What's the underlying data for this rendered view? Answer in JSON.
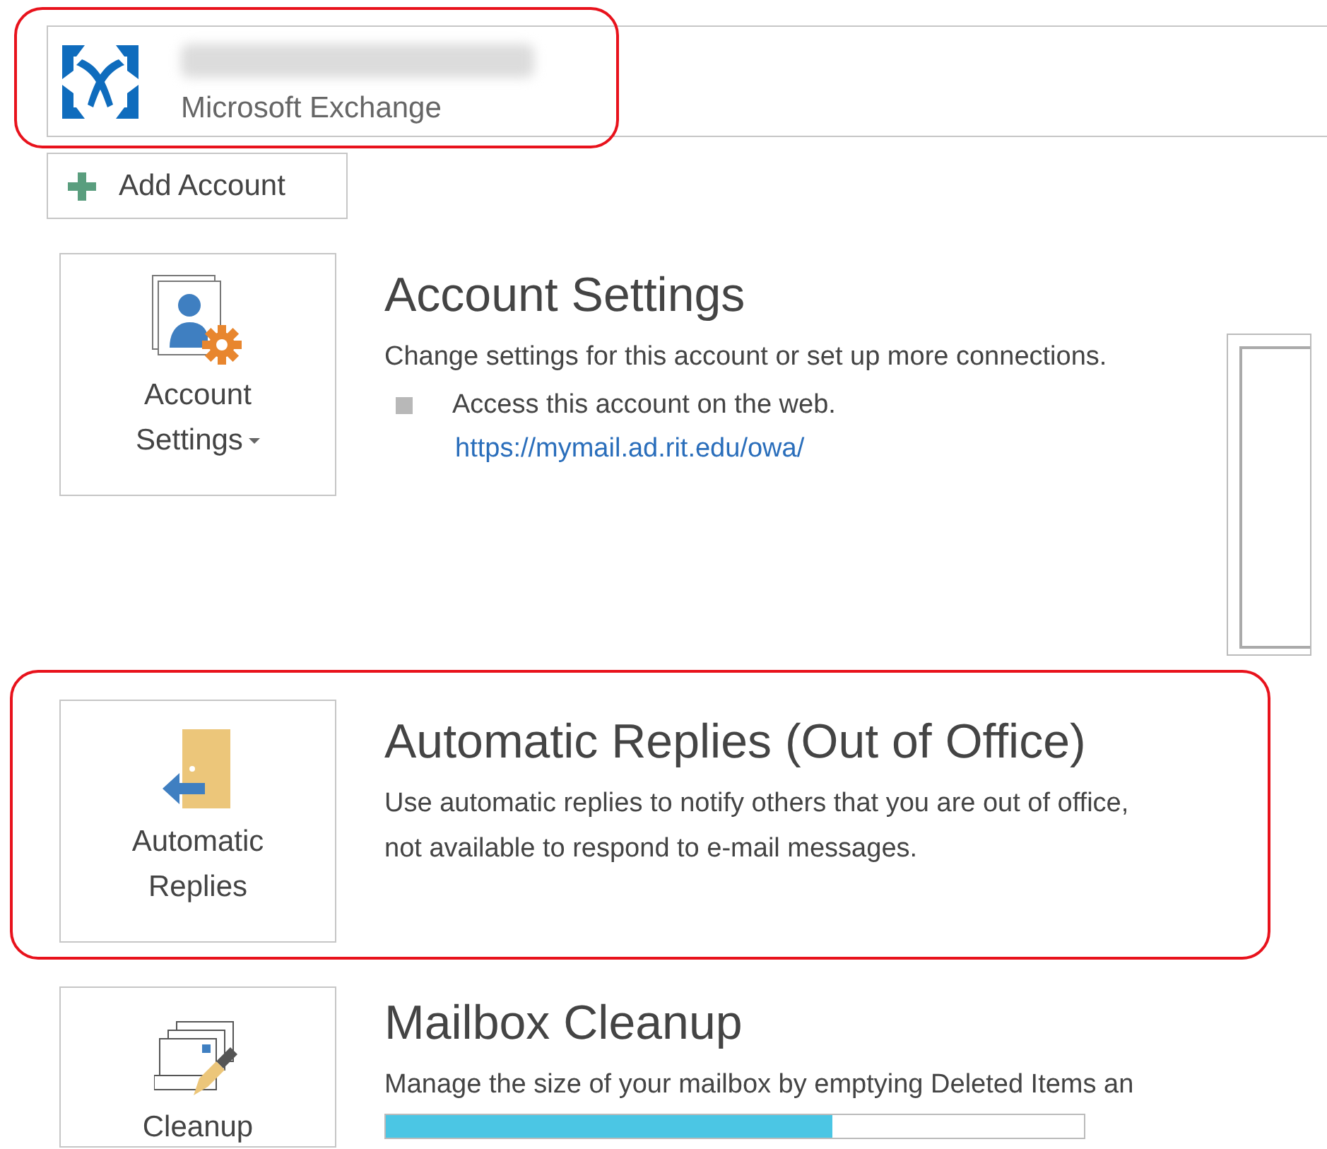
{
  "account": {
    "type": "Microsoft Exchange",
    "highlighted": true
  },
  "add_account": {
    "label": "Add Account"
  },
  "sections": [
    {
      "kind": "settings",
      "button": {
        "lines": [
          "Account",
          "Settings"
        ],
        "dropdown": true
      },
      "title": "Account Settings",
      "description": "Change settings for this account or set up more connections.",
      "bullet": "Access this account on the web.",
      "link": "https://mymail.ad.rit.edu/owa/",
      "highlighted": false
    },
    {
      "kind": "replies",
      "button": {
        "lines": [
          "Automatic",
          "Replies"
        ],
        "dropdown": false
      },
      "title": "Automatic Replies (Out of Office)",
      "description": "Use automatic replies to notify others that you are out of office,\nnot available to respond to e-mail messages.",
      "highlighted": true
    },
    {
      "kind": "cleanup",
      "button": {
        "lines": [
          "Cleanup"
        ],
        "dropdown": false
      },
      "title": "Mailbox Cleanup",
      "description": "Manage the size of your mailbox by emptying Deleted Items an",
      "level": 0.64,
      "highlighted": false
    }
  ]
}
